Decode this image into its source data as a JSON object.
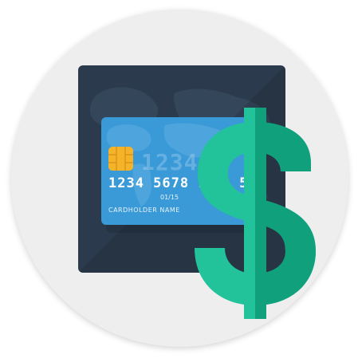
{
  "icon": {
    "name": "credit-card-dollar-icon",
    "colors": {
      "background_disc": "#eeeeee",
      "panel": "#2b3a4c",
      "card": "#3a9ad8",
      "chip": "#f4b328",
      "dollar_light": "#22c39a",
      "dollar_dark": "#10a07c"
    }
  },
  "card": {
    "emboss_text": "1234",
    "number": "1234 5678 91",
    "number_tail": "56",
    "expiry": "01/15",
    "holder": "CARDHOLDER NAME"
  },
  "symbol": {
    "glyph": "dollar-sign-icon"
  }
}
